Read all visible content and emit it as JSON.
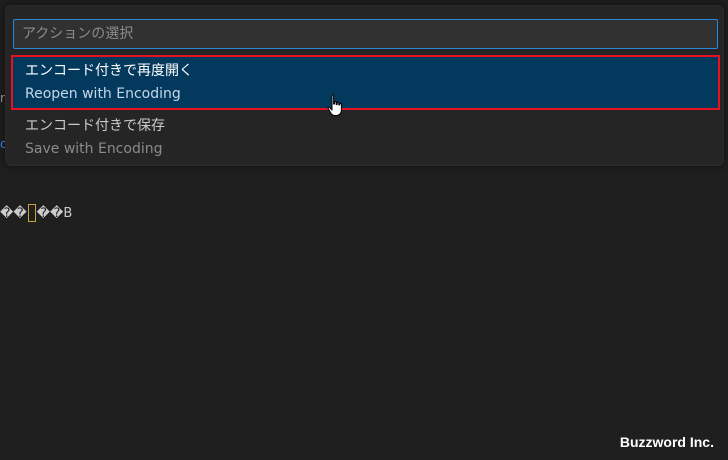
{
  "quick_pick": {
    "input_placeholder": "アクションの選択",
    "items": [
      {
        "label": "エンコード付きで再度開く",
        "description": "Reopen with Encoding",
        "selected": true
      },
      {
        "label": "エンコード付きで保存",
        "description": "Save with Encoding",
        "selected": false
      }
    ]
  },
  "editor": {
    "line_prefix": "��",
    "line_suffix": "��B",
    "edge_fragment_1": "r",
    "edge_fragment_2": "c"
  },
  "watermark": "Buzzword Inc.",
  "colors": {
    "selection_bg": "#04395e",
    "highlight_border": "#e81123",
    "focus_border": "#2488db",
    "editor_bg": "#1f1f1f"
  },
  "icons": {
    "pointer": "hand-pointer-icon"
  }
}
